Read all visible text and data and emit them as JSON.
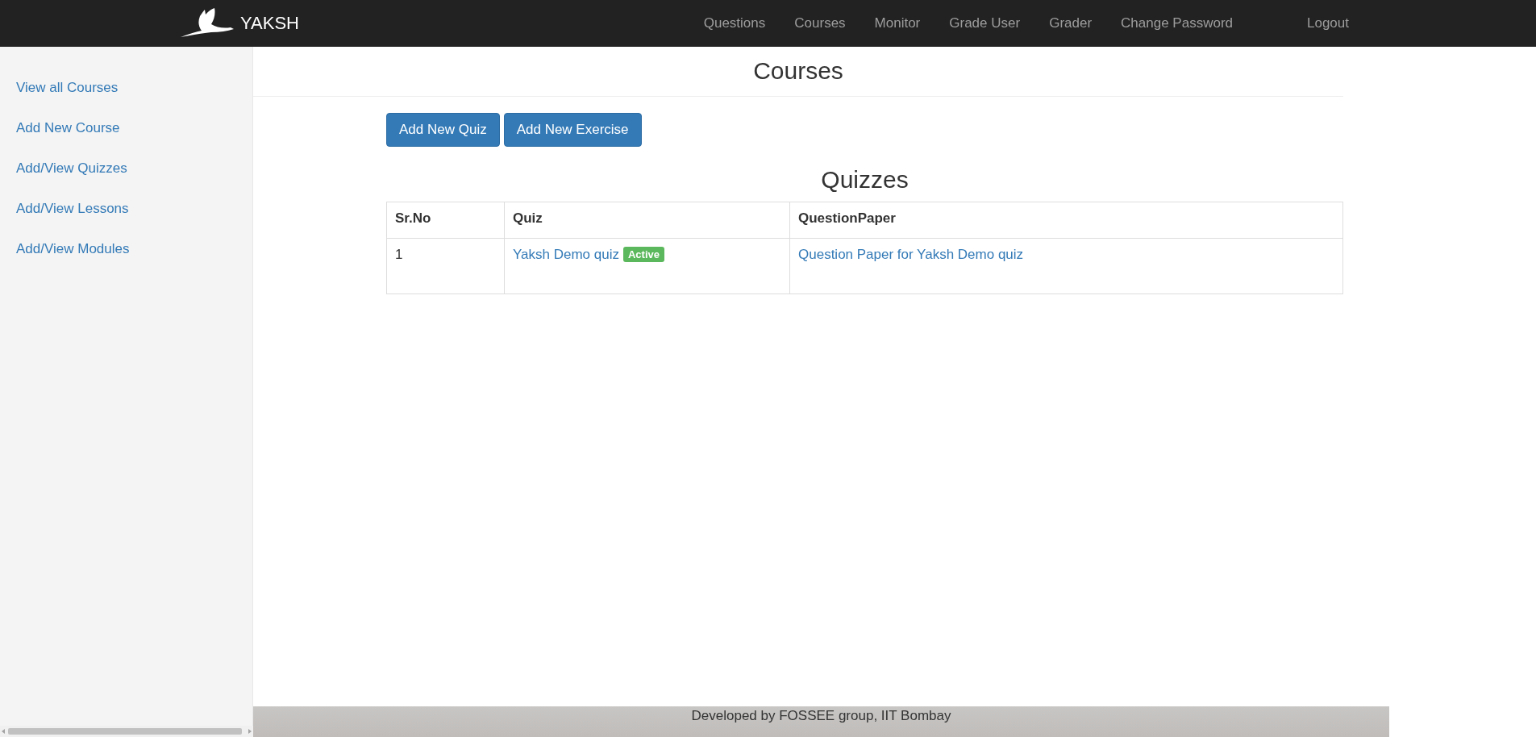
{
  "navbar": {
    "brand": "YAKSH",
    "links": [
      "Questions",
      "Courses",
      "Monitor",
      "Grade User",
      "Grader",
      "Change Password"
    ],
    "logout": "Logout"
  },
  "sidebar": {
    "items": [
      "View all Courses",
      "Add New Course",
      "Add/View Quizzes",
      "Add/View Lessons",
      "Add/View Modules"
    ]
  },
  "page_title": "Courses",
  "buttons": [
    "Add New Quiz",
    "Add New Exercise"
  ],
  "section_title": "Quizzes",
  "table": {
    "columns": [
      "Sr.No",
      "Quiz",
      "QuestionPaper"
    ],
    "rows": [
      {
        "number": "1",
        "quiz": "Yaksh Demo quiz",
        "status": "Active",
        "question_paper": "Question Paper for Yaksh Demo quiz"
      }
    ]
  },
  "footer": "Developed by FOSSEE group, IIT Bombay"
}
